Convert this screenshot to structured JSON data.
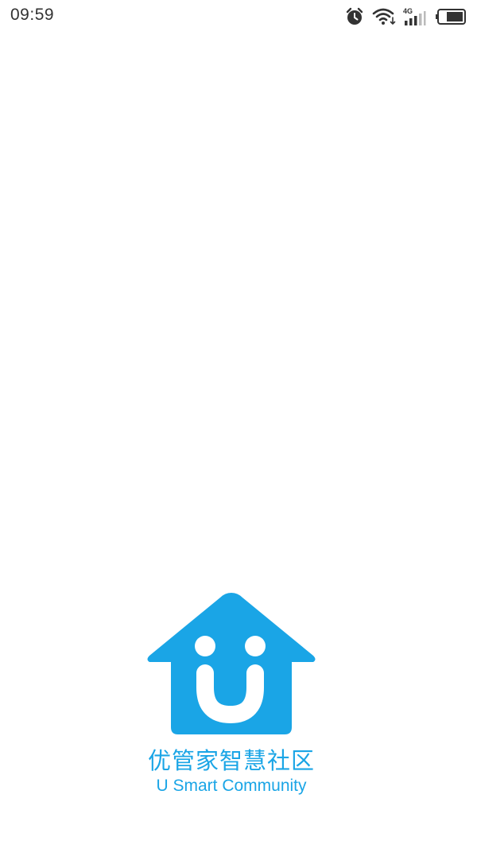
{
  "status_bar": {
    "time": "09:59",
    "network_label": "4G",
    "icons": [
      "alarm-icon",
      "wifi-icon",
      "signal-icon",
      "battery-icon"
    ]
  },
  "splash": {
    "name_cn": "优管家智慧社区",
    "name_en": "U Smart Community"
  },
  "colors": {
    "brand": "#1aa5e6",
    "background": "#ffffff",
    "status_text": "#333333"
  }
}
